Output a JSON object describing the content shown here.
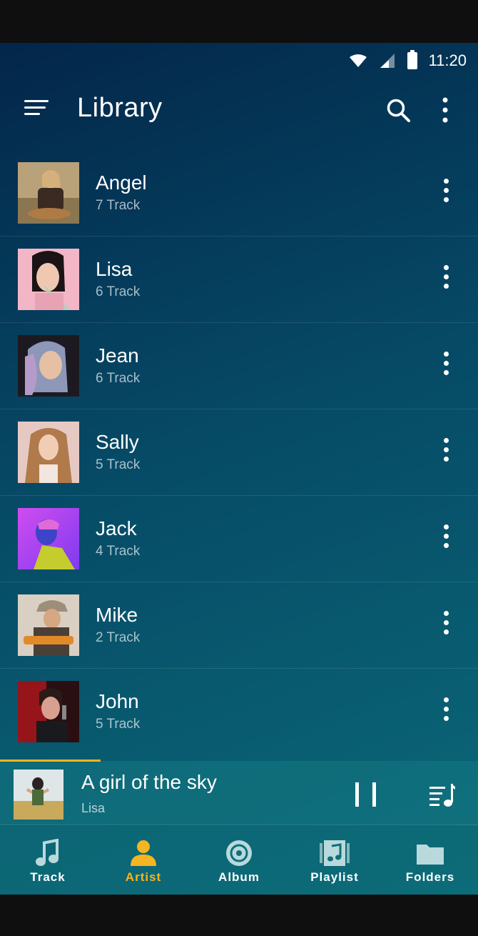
{
  "status": {
    "time": "11:20"
  },
  "header": {
    "title": "Library"
  },
  "artists": [
    {
      "name": "Angel",
      "tracks": "7 Track"
    },
    {
      "name": "Lisa",
      "tracks": "6 Track"
    },
    {
      "name": "Jean",
      "tracks": "6 Track"
    },
    {
      "name": "Sally",
      "tracks": "5 Track"
    },
    {
      "name": "Jack",
      "tracks": "4 Track"
    },
    {
      "name": "Mike",
      "tracks": "2 Track"
    },
    {
      "name": "John",
      "tracks": "5 Track"
    }
  ],
  "now_playing": {
    "title": "A girl of the sky",
    "artist": "Lisa",
    "progress": 0.21
  },
  "tabs": [
    {
      "label": "Track",
      "icon": "music-note-icon"
    },
    {
      "label": "Artist",
      "icon": "person-icon",
      "active": true
    },
    {
      "label": "Album",
      "icon": "disc-icon"
    },
    {
      "label": "Playlist",
      "icon": "playlist-icon"
    },
    {
      "label": "Folders",
      "icon": "folder-icon"
    }
  ],
  "colors": {
    "accent": "#f5b520",
    "bg_top": "#03264a",
    "bg_bottom": "#0b6a78"
  }
}
